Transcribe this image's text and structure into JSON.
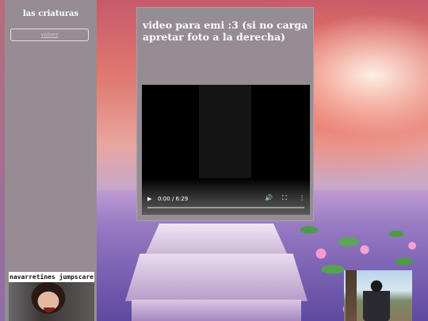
{
  "sidebar": {
    "title": "las criaturas",
    "back_label": "volver",
    "jumpscare_label": "navarretines jumpscare"
  },
  "card": {
    "title": "video para emi :3 (si no carga apretar foto a la derecha)"
  },
  "video": {
    "time": "0:00 / 6:29",
    "play_icon": "play-icon",
    "volume_icon": "volume-icon",
    "fullscreen_icon": "fullscreen-icon",
    "more_icon": "more-options-icon",
    "progress": 0
  },
  "colors": {
    "panel": "#968c94",
    "title_text": "#ffffff",
    "link": "#e8bcd8"
  }
}
